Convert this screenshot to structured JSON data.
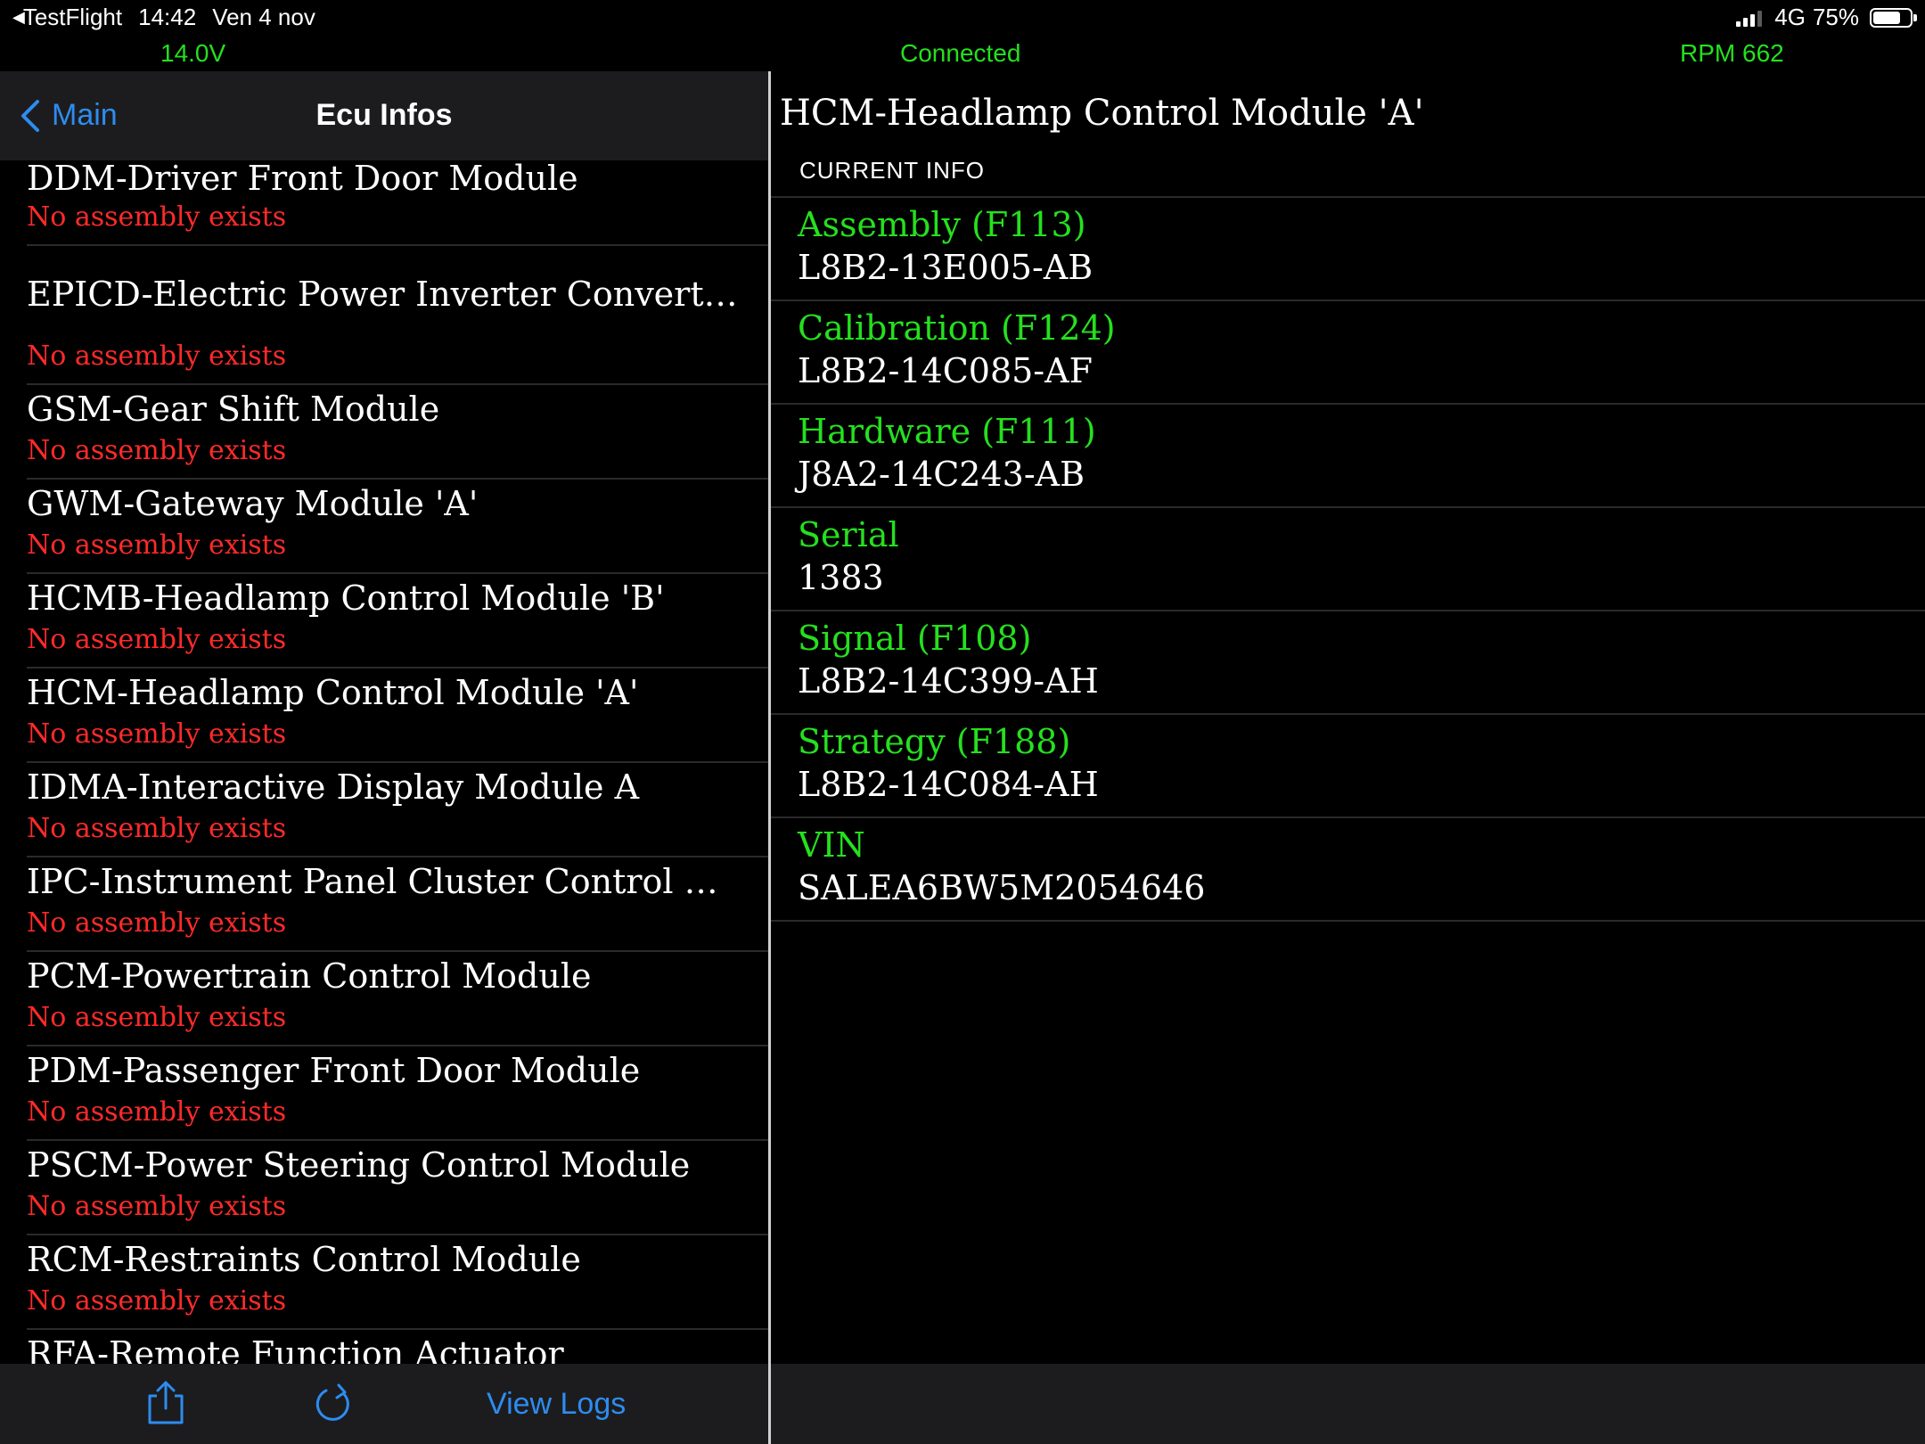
{
  "status_bar": {
    "back_app": "TestFlight",
    "time": "14:42",
    "date": "Ven 4 nov",
    "network": "4G",
    "battery": "75%",
    "battery_level": 0.75
  },
  "obd": {
    "voltage": "14.0V",
    "connection": "Connected",
    "rpm": "RPM 662"
  },
  "nav": {
    "back_label": "Main",
    "title": "Ecu Infos"
  },
  "modules": [
    {
      "name": "DDM-Driver Front Door Module",
      "status": "No assembly exists"
    },
    {
      "name": "EPICD-Electric Power Inverter Converter Co…",
      "status": "No assembly exists"
    },
    {
      "name": "GSM-Gear Shift Module",
      "status": "No assembly exists"
    },
    {
      "name": "GWM-Gateway Module 'A'",
      "status": "No assembly exists"
    },
    {
      "name": "HCMB-Headlamp Control Module 'B'",
      "status": "No assembly exists"
    },
    {
      "name": "HCM-Headlamp Control Module 'A'",
      "status": "No assembly exists"
    },
    {
      "name": "IDMA-Interactive Display Module A",
      "status": "No assembly exists"
    },
    {
      "name": "IPC-Instrument Panel Cluster Control Module",
      "status": "No assembly exists"
    },
    {
      "name": "PCM-Powertrain Control Module",
      "status": "No assembly exists"
    },
    {
      "name": "PDM-Passenger Front Door Module",
      "status": "No assembly exists"
    },
    {
      "name": "PSCM-Power Steering Control Module",
      "status": "No assembly exists"
    },
    {
      "name": "RCM-Restraints Control Module",
      "status": "No assembly exists"
    },
    {
      "name": "RFA-Remote Function Actuator",
      "status": ""
    }
  ],
  "toolbar": {
    "share_icon": "share-icon",
    "refresh_icon": "refresh-icon",
    "logs_label": "View Logs"
  },
  "detail": {
    "title": "HCM-Headlamp Control Module 'A'",
    "section": "CURRENT INFO",
    "items": [
      {
        "label": "Assembly (F113)",
        "value": "L8B2-13E005-AB"
      },
      {
        "label": "Calibration (F124)",
        "value": "L8B2-14C085-AF"
      },
      {
        "label": "Hardware (F111)",
        "value": "J8A2-14C243-AB"
      },
      {
        "label": "Serial",
        "value": "1383"
      },
      {
        "label": "Signal (F108)",
        "value": "L8B2-14C399-AH"
      },
      {
        "label": "Strategy (F188)",
        "value": "L8B2-14C084-AH"
      },
      {
        "label": "VIN",
        "value": "SALEA6BW5M2054646"
      }
    ]
  },
  "colors": {
    "accent_blue": "#2d8cf0",
    "status_green": "#25e01e",
    "error_red": "#ff2a2a"
  }
}
